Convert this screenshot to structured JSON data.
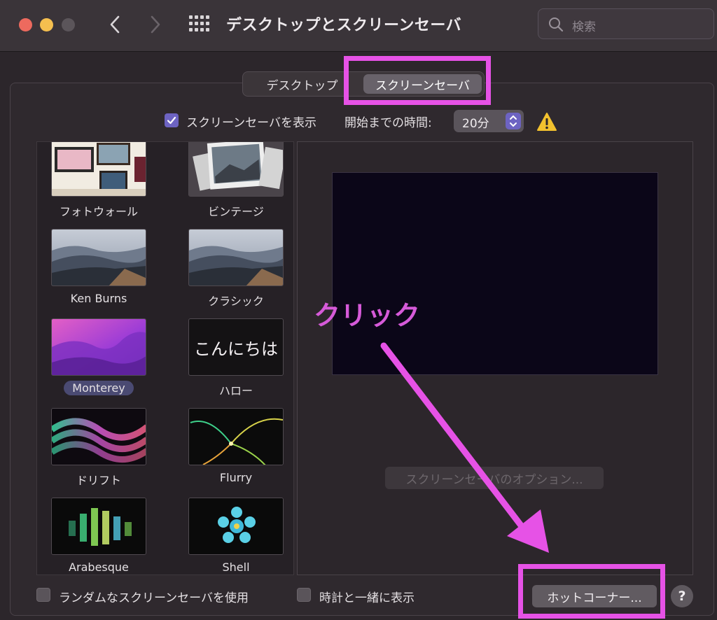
{
  "window": {
    "title": "デスクトップとスクリーンセーバ",
    "search_placeholder": "検索"
  },
  "tabs": [
    {
      "label": "デスクトップ",
      "selected": false
    },
    {
      "label": "スクリーンセーバ",
      "selected": true
    }
  ],
  "show_saver": {
    "checked": true,
    "label": "スクリーンセーバを表示",
    "start_label": "開始までの時間:",
    "start_value": "20分"
  },
  "savers": [
    {
      "label": "フォトウォール"
    },
    {
      "label": "ビンテージ"
    },
    {
      "label": "Ken Burns"
    },
    {
      "label": "クラシック"
    },
    {
      "label": "Monterey",
      "selected": true
    },
    {
      "label": "ハロー",
      "thumb_text": "こんにちは"
    },
    {
      "label": "ドリフト"
    },
    {
      "label": "Flurry"
    },
    {
      "label": "Arabesque"
    },
    {
      "label": "Shell"
    }
  ],
  "preview": {
    "options_button": "スクリーンセーバのオプション..."
  },
  "bottom": {
    "random_label": "ランダムなスクリーンセーバを使用",
    "clock_label": "時計と一緒に表示",
    "hot_corners_button": "ホットコーナー...",
    "help": "?"
  },
  "annotation": {
    "text": "クリック",
    "color": "#e652e6"
  }
}
